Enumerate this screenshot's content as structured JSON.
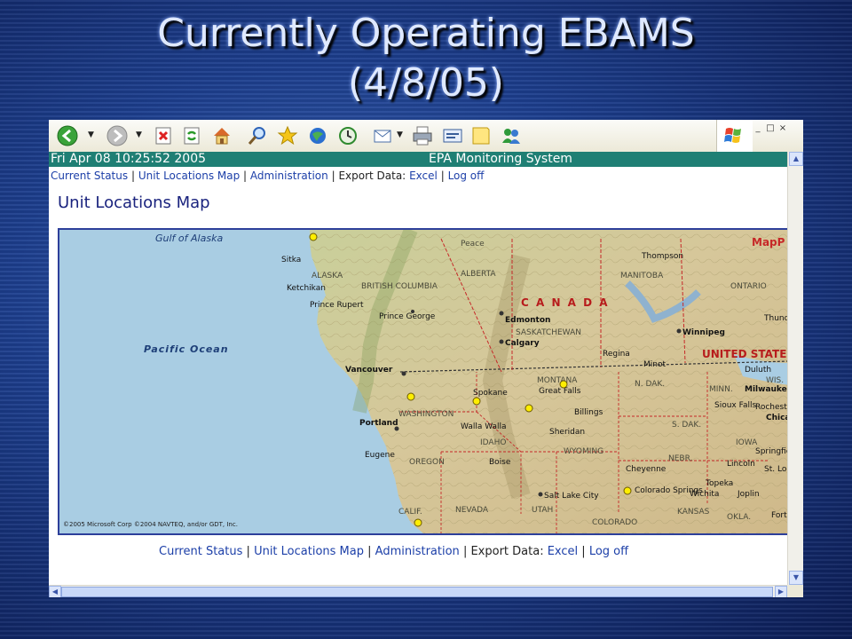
{
  "slide": {
    "title_line1": "Currently Operating EBAMS",
    "title_line2": "(4/8/05)"
  },
  "toolbar": {
    "icons": [
      "back-icon",
      "forward-icon",
      "stop-icon",
      "refresh-icon",
      "home-icon",
      "search-icon",
      "favorites-icon",
      "media-icon",
      "history-icon",
      "mail-icon",
      "print-icon",
      "edit-icon",
      "discuss-icon",
      "messenger-icon"
    ],
    "window_buttons": [
      "_",
      "□",
      "×"
    ]
  },
  "status_bar": {
    "datetime": "Fri Apr 08 10:25:52 2005",
    "system_name": "EPA Monitoring System"
  },
  "nav": {
    "current_status": "Current Status",
    "unit_locations_map": "Unit Locations Map",
    "administration": "Administration",
    "export_data": "Export Data:",
    "excel": "Excel",
    "log_off": "Log off",
    "separator": "|"
  },
  "page": {
    "heading": "Unit Locations Map"
  },
  "map": {
    "copyright": "©2005 Microsoft Corp ©2004 NAVTEQ, and/or GDT, Inc.",
    "brand": "MapP",
    "ocean_labels": [
      "Gulf of Alaska",
      "Pacific Ocean"
    ],
    "country_labels": [
      "C A N A D A",
      "UNITED STATE"
    ],
    "region_labels": [
      "ALASKA",
      "BRITISH COLUMBIA",
      "ALBERTA",
      "SASKATCHEWAN",
      "MANITOBA",
      "ONTARIO",
      "WASHINGTON",
      "OREGON",
      "IDAHO",
      "MONTANA",
      "WYOMING",
      "N. DAK.",
      "S. DAK.",
      "NEBR.",
      "MINN.",
      "WIS.",
      "IOWA",
      "UTAH",
      "NEVADA",
      "COLORADO",
      "KANSAS",
      "OKLA.",
      "CALIF.",
      "Peace"
    ],
    "city_labels": [
      "Sitka",
      "Ketchikan",
      "Prince Rupert",
      "Prince George",
      "Edmonton",
      "Calgary",
      "Regina",
      "Winnipeg",
      "Thompson",
      "Thunder Bay",
      "Vancouver",
      "Spokane",
      "Great Falls",
      "Billings",
      "Portland",
      "Walla Walla",
      "Eugene",
      "Boise",
      "Sheridan",
      "Minot",
      "Sioux Falls",
      "Duluth",
      "Milwaukee",
      "Rochester",
      "Chicago",
      "Cheyenne",
      "Lincoln",
      "Topeka",
      "Wichita",
      "Joplin",
      "Salt Lake City",
      "Colorado Springs",
      "Springfield",
      "St. Louis",
      "Fort Smith"
    ],
    "unit_markers": 7
  },
  "colors": {
    "status_bar": "#1f7f74",
    "link": "#1c3fa8",
    "heading": "#1a237e",
    "map_border": "#2d3f9a",
    "unit_marker": "#ffee00"
  }
}
